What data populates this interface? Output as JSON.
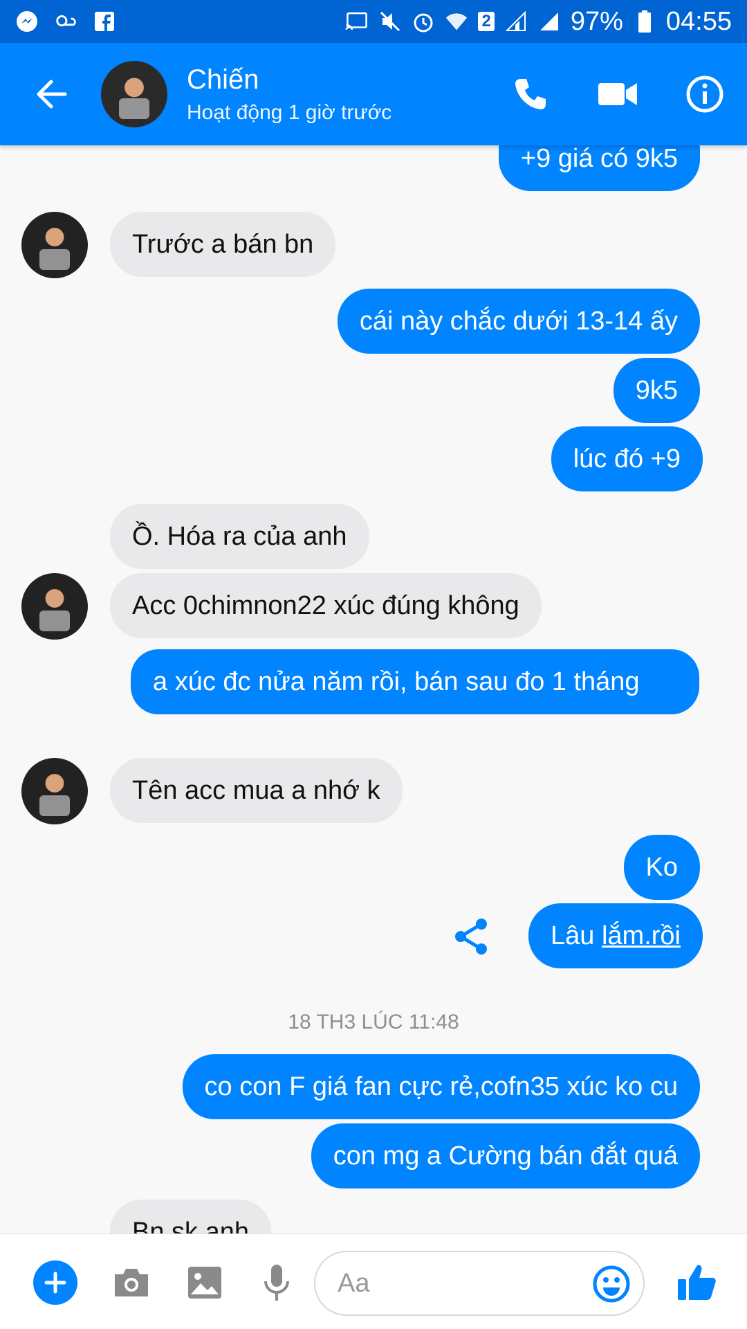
{
  "status_bar": {
    "battery": "97%",
    "time": "04:55",
    "sim_badge": "2"
  },
  "header": {
    "name": "Chiến",
    "status": "Hoạt động 1 giờ trước"
  },
  "messages": [
    {
      "dir": "out",
      "text": "+9 giá có 9k5"
    },
    {
      "dir": "in",
      "text": "Trước a bán bn"
    },
    {
      "dir": "out",
      "text": "cái này chắc dưới 13-14 ấy"
    },
    {
      "dir": "out",
      "text": "9k5"
    },
    {
      "dir": "out",
      "text": "lúc đó +9"
    },
    {
      "dir": "in",
      "text": "Ồ. Hóa ra  của anh"
    },
    {
      "dir": "in",
      "text": "Acc 0chimnon22 xúc đúng không"
    },
    {
      "dir": "out",
      "text": "a xúc đc nửa năm rồi, bán sau đo 1 tháng"
    },
    {
      "dir": "in",
      "text": "Tên acc mua a nhớ k"
    },
    {
      "dir": "out",
      "text": "Ko"
    },
    {
      "dir": "out",
      "text_plain": "Lâu ",
      "text_underlined": "lắm.rồi"
    },
    {
      "dir": "out",
      "text": "co con F giá fan cực rẻ,cofn35 xúc ko cu"
    },
    {
      "dir": "out",
      "text": "con mg a Cường bán đắt quá"
    },
    {
      "dir": "in",
      "text": "Bn sk anh"
    }
  ],
  "timestamp": "18 TH3 LÚC 11:48",
  "composer": {
    "placeholder": "Aa"
  },
  "colors": {
    "accent": "#0084ff",
    "status_bar": "#0064d2",
    "incoming_bubble": "#e9e9eb"
  }
}
